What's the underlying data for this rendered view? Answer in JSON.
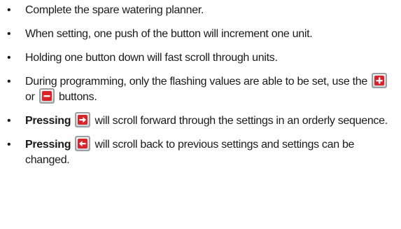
{
  "bullets": {
    "item1": {
      "text": "Complete the spare watering planner."
    },
    "item2": {
      "text": "When setting, one push of the button will increment one unit."
    },
    "item3": {
      "text": "Holding one button down will fast scroll through units."
    },
    "item4": {
      "text_a": "During programming, only the flashing values are able to be set, use the",
      "text_b": "or",
      "text_c": "buttons."
    },
    "item5": {
      "bold": "Pressing",
      "text": "will scroll forward through the settings in an orderly sequence."
    },
    "item6": {
      "bold": "Pressing",
      "text": "will scroll back to previous settings and settings can be changed."
    }
  },
  "icons": {
    "plus": "plus-button-icon",
    "minus": "minus-button-icon",
    "forward": "arrow-right-button-icon",
    "back": "arrow-left-button-icon",
    "button_color": "#d8232a"
  }
}
